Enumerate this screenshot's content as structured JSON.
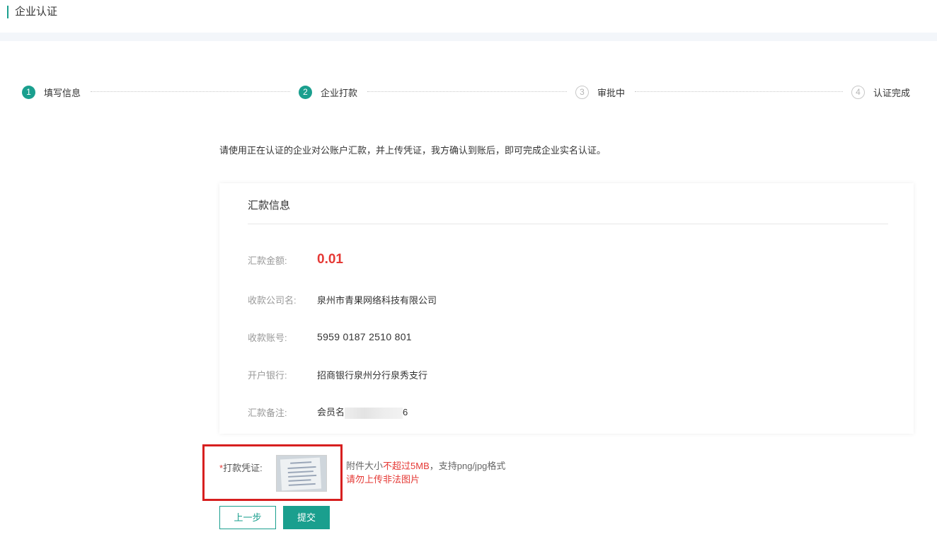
{
  "header": {
    "title": "企业认证"
  },
  "steps": [
    {
      "num": "1",
      "label": "填写信息"
    },
    {
      "num": "2",
      "label": "企业打款"
    },
    {
      "num": "3",
      "label": "审批中"
    },
    {
      "num": "4",
      "label": "认证完成"
    }
  ],
  "intro": "请使用正在认证的企业对公账户汇款，并上传凭证，我方确认到账后，即可完成企业实名认证。",
  "card": {
    "title": "汇款信息",
    "rows": [
      {
        "key": "汇款金额:",
        "value": "0.01"
      },
      {
        "key": "收款公司名:",
        "value": "泉州市青果网络科技有限公司"
      },
      {
        "key": "收款账号:",
        "value": "5959 0187 2510 801"
      },
      {
        "key": "开户银行:",
        "value": "招商银行泉州分行泉秀支行"
      },
      {
        "key": "汇款备注:",
        "value_prefix": "会员名",
        "value_suffix": "6"
      }
    ]
  },
  "upload": {
    "required_mark": "*",
    "label": "打款凭证:",
    "hint_prefix": "附件大小",
    "hint_red": "不超过5MB",
    "hint_suffix": "，支持png/jpg格式",
    "warning": "请勿上传非法图片"
  },
  "buttons": {
    "prev": "上一步",
    "submit": "提交"
  },
  "colors": {
    "accent": "#1a9f8e",
    "danger": "#e53935",
    "highlight_box": "#d71f1f"
  }
}
